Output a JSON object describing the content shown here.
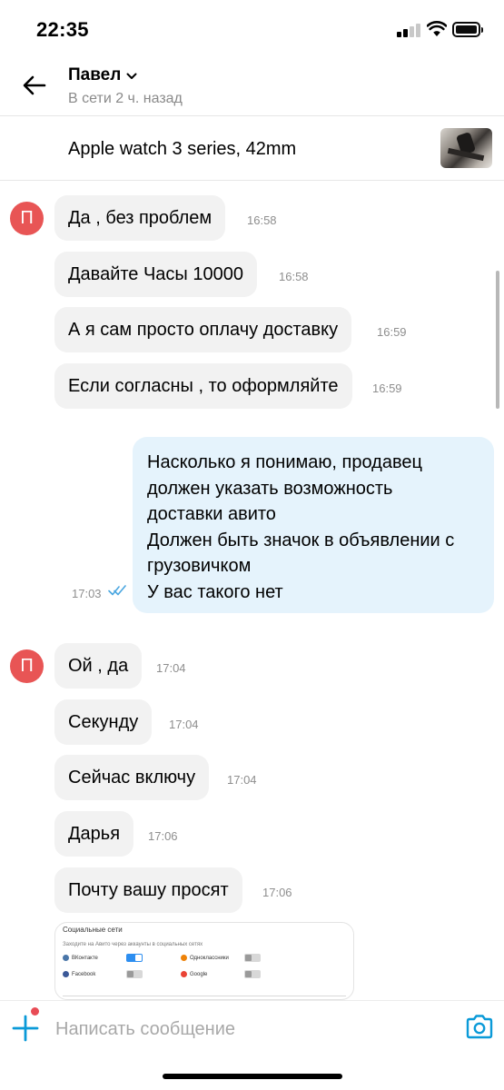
{
  "status_bar": {
    "time": "22:35"
  },
  "header": {
    "contact_name": "Павел",
    "contact_status": "В сети 2 ч. назад"
  },
  "listing": {
    "title": "Apple watch 3 series, 42mm"
  },
  "messages": [
    {
      "avatar": "П",
      "text": "Да , без проблем",
      "time": "16:58"
    },
    {
      "text": "Давайте Часы 10000",
      "time": "16:58"
    },
    {
      "text": "А я сам просто оплачу доставку",
      "time": "16:59"
    },
    {
      "text": "Если согласны , то оформляйте",
      "time": "16:59"
    },
    {
      "outgoing": true,
      "lines": [
        "Насколько я понимаю, продавец",
        "должен указать возможность",
        "доставки авито",
        "Должен быть значок в объявлении с",
        "грузовичком",
        "У вас такого нет"
      ],
      "time": "17:03",
      "status_icon": "double-check-icon"
    },
    {
      "avatar": "П",
      "text": "Ой , да",
      "time": "17:04"
    },
    {
      "text": "Секунду",
      "time": "17:04"
    },
    {
      "text": "Сейчас включу",
      "time": "17:04"
    },
    {
      "text": "Дарья",
      "time": "17:06"
    },
    {
      "text": "Почту вашу просят",
      "time": "17:06"
    }
  ],
  "image_preview": {
    "title": "Социальные сети",
    "subtitle": "Заходите на Авито через аккаунты в социальных сетях",
    "items": [
      {
        "label": "ВКонтакте",
        "enabled": true,
        "color": "#4a76a8"
      },
      {
        "label": "Одноклассники",
        "enabled": false,
        "color": "#ee8208"
      },
      {
        "label": "Facebook",
        "enabled": false,
        "color": "#3b5998"
      },
      {
        "label": "Google",
        "enabled": false,
        "color": "#ea4335"
      }
    ]
  },
  "composer": {
    "placeholder": "Написать сообщение"
  },
  "colors": {
    "accent": "#0a9ad8",
    "avatar": "#e85555",
    "incoming_bubble": "#f2f2f2",
    "outgoing_bubble": "#e5f3fc",
    "notification_dot": "#e84b55"
  }
}
